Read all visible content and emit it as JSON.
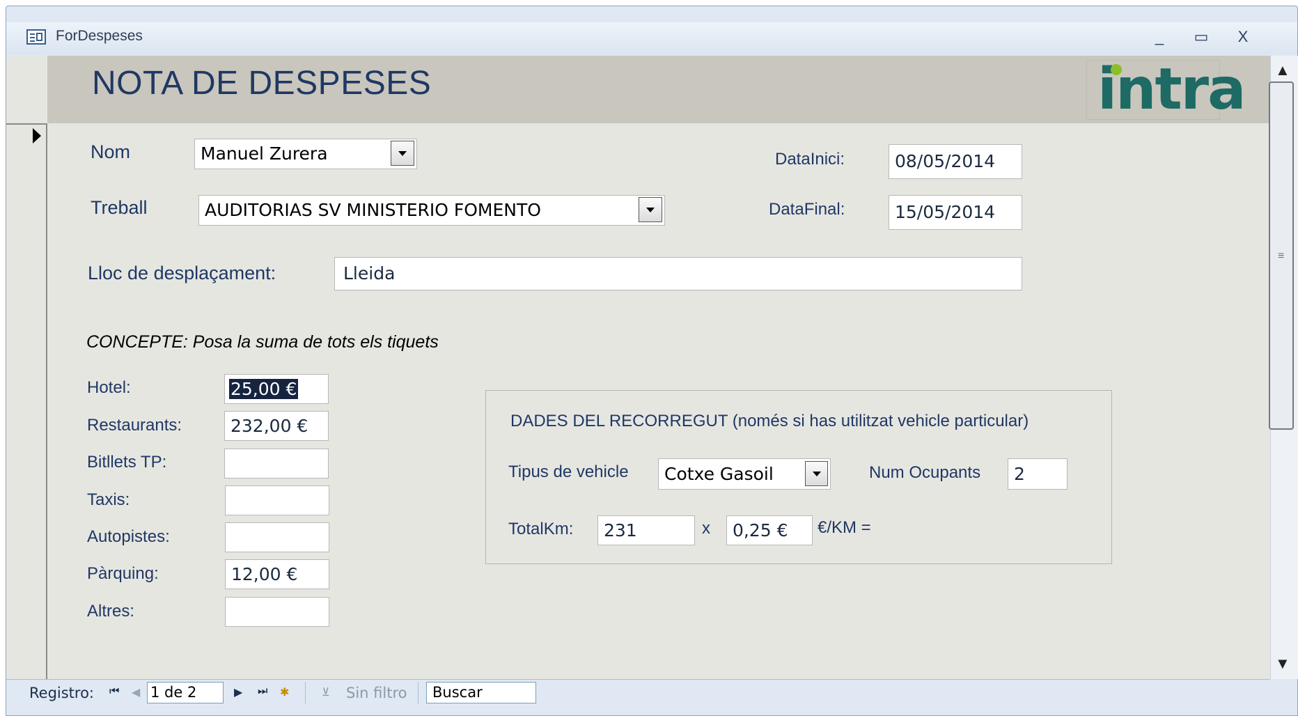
{
  "window": {
    "title": "ForDespeses",
    "minimize_glyph": "_",
    "maximize_glyph": "▭",
    "close_glyph": "X"
  },
  "form": {
    "title": "NOTA DE DESPESES",
    "logo_text": "intra",
    "fields": {
      "nom_label": "Nom",
      "nom_value": "Manuel Zurera",
      "treball_label": "Treball",
      "treball_value": "AUDITORIAS SV MINISTERIO FOMENTO",
      "data_inici_label": "DataInici:",
      "data_inici_value": "08/05/2014",
      "data_final_label": "DataFinal:",
      "data_final_value": "15/05/2014",
      "lloc_label": "Lloc de desplaçament:",
      "lloc_value": "Lleida"
    },
    "concepte": {
      "heading": "CONCEPTE: Posa la suma de tots els tiquets",
      "items": [
        {
          "label": "Hotel:",
          "value": "25,00 €"
        },
        {
          "label": "Restaurants:",
          "value": "232,00 €"
        },
        {
          "label": "Bitllets TP:",
          "value": ""
        },
        {
          "label": "Taxis:",
          "value": ""
        },
        {
          "label": "Autopistes:",
          "value": ""
        },
        {
          "label": "Pàrquing:",
          "value": "12,00 €"
        },
        {
          "label": "Altres:",
          "value": ""
        }
      ]
    },
    "recorregut": {
      "heading": "DADES DEL RECORREGUT (només si has utilitzat vehicle particular)",
      "tipus_label": "Tipus de vehicle",
      "tipus_value": "Cotxe Gasoil",
      "ocupants_label": "Num Ocupants",
      "ocupants_value": "2",
      "totalkm_label": "TotalKm:",
      "totalkm_value": "231",
      "times": "x",
      "price_value": "0,25 €",
      "per_km_label": "€/KM ="
    }
  },
  "navbar": {
    "registro_label": "Registro:",
    "first_icon": "first-record-icon",
    "prev_icon": "previous-record-icon",
    "record_value": "1 de 2",
    "next_icon": "next-record-icon",
    "last_icon": "last-record-icon",
    "new_icon": "new-record-icon",
    "filter_label": "Sin filtro",
    "search_value": "Buscar"
  }
}
